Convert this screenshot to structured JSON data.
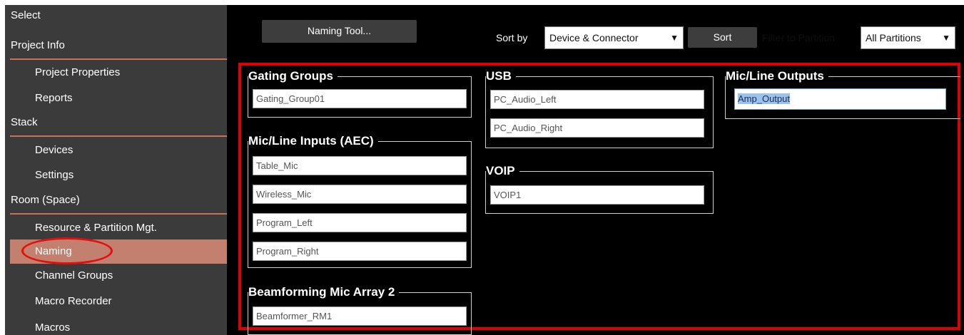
{
  "sidebar": {
    "items": [
      {
        "label": "Select",
        "kind": "head"
      },
      {
        "label": "Project Info",
        "kind": "head"
      },
      {
        "label": "Project Properties",
        "kind": "sub"
      },
      {
        "label": "Reports",
        "kind": "sub"
      },
      {
        "label": "Stack",
        "kind": "head"
      },
      {
        "label": "Devices",
        "kind": "sub"
      },
      {
        "label": "Settings",
        "kind": "sub"
      },
      {
        "label": "Room (Space)",
        "kind": "head"
      },
      {
        "label": "Resource & Partition Mgt.",
        "kind": "sub"
      },
      {
        "label": "Naming",
        "kind": "sub",
        "selected": true
      },
      {
        "label": "Channel Groups",
        "kind": "sub"
      },
      {
        "label": "Macro Recorder",
        "kind": "sub"
      },
      {
        "label": "Macros",
        "kind": "sub"
      }
    ]
  },
  "toolbar": {
    "naming_tool_label": "Naming Tool...",
    "sort_by_label": "Sort by",
    "sort_by_value": "Device & Connector",
    "sort_button_label": "Sort",
    "filter_label": "Filter to Partition",
    "filter_value": "All Partitions"
  },
  "groups": {
    "gating": {
      "title": "Gating Groups",
      "fields": [
        "Gating_Group01"
      ]
    },
    "mic_inputs": {
      "title": "Mic/Line Inputs (AEC)",
      "fields": [
        "Table_Mic",
        "Wireless_Mic",
        "Program_Left",
        "Program_Right"
      ]
    },
    "beamforming": {
      "title": "Beamforming Mic Array 2",
      "fields": [
        "Beamformer_RM1"
      ]
    },
    "usb": {
      "title": "USB",
      "fields": [
        "PC_Audio_Left",
        "PC_Audio_Right"
      ]
    },
    "voip": {
      "title": "VOIP",
      "fields": [
        "VOIP1"
      ]
    },
    "outputs": {
      "title": "Mic/Line Outputs",
      "fields": [
        "Amp_Output"
      ]
    }
  },
  "colors": {
    "sidebar_bg": "#3b3b3b",
    "sidebar_selected": "#c4806e",
    "sidebar_rule": "#c96f5a",
    "annotation_red": "#e00000",
    "selection_highlight": "#9cc3ee"
  }
}
